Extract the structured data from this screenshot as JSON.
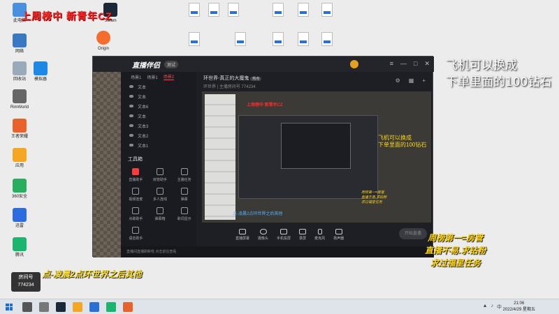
{
  "overlay": {
    "top_red": "上周榜中 新青年CZ",
    "right_lines": [
      "飞机可以换成",
      "下单里面的100钻石"
    ],
    "rb_lines": [
      "周榜第一=房管",
      "直播不易.求钻粉",
      "求过福星任务"
    ],
    "bl_text": "点-凌晨2点环世界之后其他",
    "live_badge_label": "房间号",
    "live_badge_value": "774234"
  },
  "desktop_icons": [
    {
      "label": "此电脑",
      "kind": "app"
    },
    {
      "label": "网络",
      "kind": "app"
    },
    {
      "label": "回收站",
      "kind": "app"
    },
    {
      "label": "RimWorld",
      "kind": "app"
    },
    {
      "label": "王者荣耀",
      "kind": "app"
    },
    {
      "label": "应用",
      "kind": "app"
    },
    {
      "label": "360安全",
      "kind": "app"
    },
    {
      "label": "迅雷",
      "kind": "app"
    },
    {
      "label": "腾讯",
      "kind": "app"
    },
    {
      "label": "模拟器",
      "kind": "app"
    },
    {
      "label": "Steam",
      "kind": "app"
    },
    {
      "label": "Origin",
      "kind": "app"
    }
  ],
  "window": {
    "app_name": "直播伴侣",
    "beta": "测试",
    "scene_tabs": [
      "场景1",
      "场景1",
      "场景2"
    ],
    "sources": [
      "文本",
      "文本",
      "文本6",
      "文本",
      "文本3",
      "文本2",
      "文本1"
    ],
    "tools_title": "工具箱",
    "tools": [
      "直播助手",
      "房管助手",
      "主播任务",
      "视频连麦",
      "多人连线",
      "弹幕",
      "点歌助手",
      "弹幕箱",
      "歌词显示",
      "语音助手"
    ],
    "preview_title": "环世界-真正的大魔鬼",
    "preview_tag": "热点",
    "preview_sub": "环世界  | 主播房间号 774234",
    "preview_overlay_text": [
      "飞机可以换成",
      "下单里面的100钻石"
    ],
    "preview_small_text": [
      "周榜第一=房管",
      "直播不易.求钻粉",
      "求过福星任务"
    ],
    "preview_red": "上周榜中 新青年CZ",
    "preview_cyan": "点-凌晨2点环世界之后其他",
    "toolbar": [
      "直播屏幕",
      "摄像头",
      "手机投屏",
      "录屏",
      "麦克风",
      "扬声器"
    ],
    "start_live": "开始直播",
    "status": "直播间直播刷新啦 点击前往查看"
  },
  "taskbar": {
    "time": "21:06",
    "date": "2022/4/29 星期五"
  },
  "colors": {
    "accent_red": "#ff3b3b",
    "overlay_yellow": "#ffd51a"
  }
}
